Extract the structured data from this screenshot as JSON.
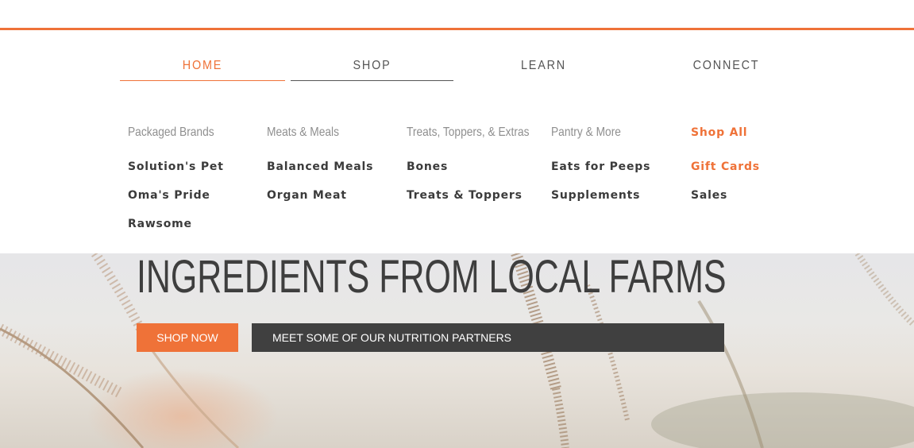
{
  "colors": {
    "accent": "#ef7238",
    "dark": "#404040",
    "text": "#3b3b3b",
    "muted": "#8f8f8f"
  },
  "nav": {
    "items": [
      {
        "label": "HOME",
        "active": true
      },
      {
        "label": "SHOP",
        "active": false
      },
      {
        "label": "LEARN",
        "active": false
      },
      {
        "label": "CONNECT",
        "active": false
      }
    ]
  },
  "mega_menu": {
    "columns": [
      {
        "heading": "Packaged Brands",
        "links": [
          "Solution's Pet",
          "Oma's Pride",
          "Rawsome"
        ]
      },
      {
        "heading": "Meats & Meals",
        "links": [
          "Balanced Meals",
          "Organ Meat"
        ]
      },
      {
        "heading": "Treats, Toppers, & Extras",
        "links": [
          "Bones",
          "Treats & Toppers"
        ]
      },
      {
        "heading": "Pantry & More",
        "links": [
          "Eats for Peeps",
          "Supplements"
        ]
      },
      {
        "heading": "Shop All",
        "links": [
          "Gift Cards",
          "Sales"
        ]
      }
    ]
  },
  "hero": {
    "title": "INGREDIENTS FROM LOCAL FARMS",
    "primary_button": "SHOP NOW",
    "secondary_button": "MEET SOME OF OUR NUTRITION PARTNERS"
  }
}
